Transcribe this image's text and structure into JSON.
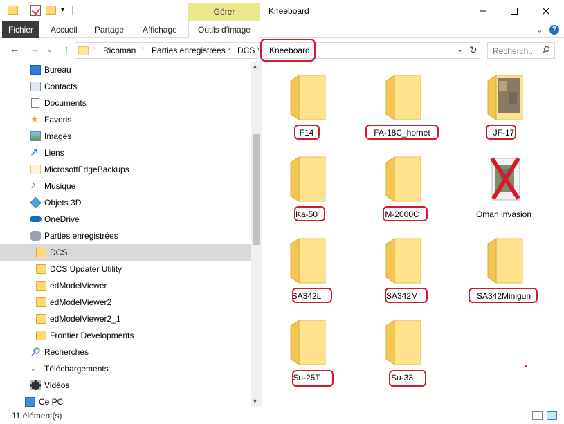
{
  "title_bar": {
    "context_tab_header": "Gérer",
    "window_title": "Kneeboard",
    "minimize_icon": "minimize-icon",
    "maximize_icon": "maximize-icon",
    "close_icon": "close-icon"
  },
  "ribbon": {
    "tabs": [
      "Fichier",
      "Accueil",
      "Partage",
      "Affichage",
      "Outils d’image"
    ]
  },
  "address_bar": {
    "breadcrumbs": [
      "Richman",
      "Parties enregistrées",
      "DCS",
      "Kneeboard"
    ],
    "search_placeholder": "Recherch..."
  },
  "sidebar": {
    "items": [
      {
        "label": "Bureau",
        "icon": "desktop-icon"
      },
      {
        "label": "Contacts",
        "icon": "contacts-icon"
      },
      {
        "label": "Documents",
        "icon": "documents-icon"
      },
      {
        "label": "Favoris",
        "icon": "star-icon"
      },
      {
        "label": "Images",
        "icon": "images-icon"
      },
      {
        "label": "Liens",
        "icon": "link-icon"
      },
      {
        "label": "MicrosoftEdgeBackups",
        "icon": "folder-icon"
      },
      {
        "label": "Musique",
        "icon": "music-icon"
      },
      {
        "label": "Objets 3D",
        "icon": "cube-icon"
      },
      {
        "label": "OneDrive",
        "icon": "cloud-icon"
      },
      {
        "label": "Parties enregistrées",
        "icon": "saved-games-icon"
      },
      {
        "label": "DCS",
        "icon": "folder-icon"
      },
      {
        "label": "DCS Updater Utility",
        "icon": "folder-icon"
      },
      {
        "label": "edModelViewer",
        "icon": "folder-icon"
      },
      {
        "label": "edModelViewer2",
        "icon": "folder-icon"
      },
      {
        "label": "edModelViewer2_1",
        "icon": "folder-icon"
      },
      {
        "label": "Frontier Developments",
        "icon": "folder-icon"
      },
      {
        "label": "Recherches",
        "icon": "search-icon"
      },
      {
        "label": "Téléchargements",
        "icon": "download-icon"
      },
      {
        "label": "Vidéos",
        "icon": "video-icon"
      },
      {
        "label": "Ce PC",
        "icon": "computer-icon"
      }
    ]
  },
  "content": {
    "items": [
      {
        "label": "F14",
        "type": "folder"
      },
      {
        "label": "FA-18C_hornet",
        "type": "folder"
      },
      {
        "label": "JF-17",
        "type": "folder-with-images"
      },
      {
        "label": "Ka-50",
        "type": "folder"
      },
      {
        "label": "M-2000C",
        "type": "folder"
      },
      {
        "label": "Oman invasion",
        "type": "file-marked-x"
      },
      {
        "label": "SA342L",
        "type": "folder"
      },
      {
        "label": "SA342M",
        "type": "folder"
      },
      {
        "label": "SA342Minigun",
        "type": "folder"
      },
      {
        "label": "Su-25T",
        "type": "folder"
      },
      {
        "label": "Su-33",
        "type": "folder"
      }
    ]
  },
  "status_bar": {
    "count": "11 élément(s)"
  },
  "colors": {
    "annotation_red": "#d61a2c",
    "context_tab": "#ebe98c",
    "folder_yellow": "#ffd971"
  }
}
